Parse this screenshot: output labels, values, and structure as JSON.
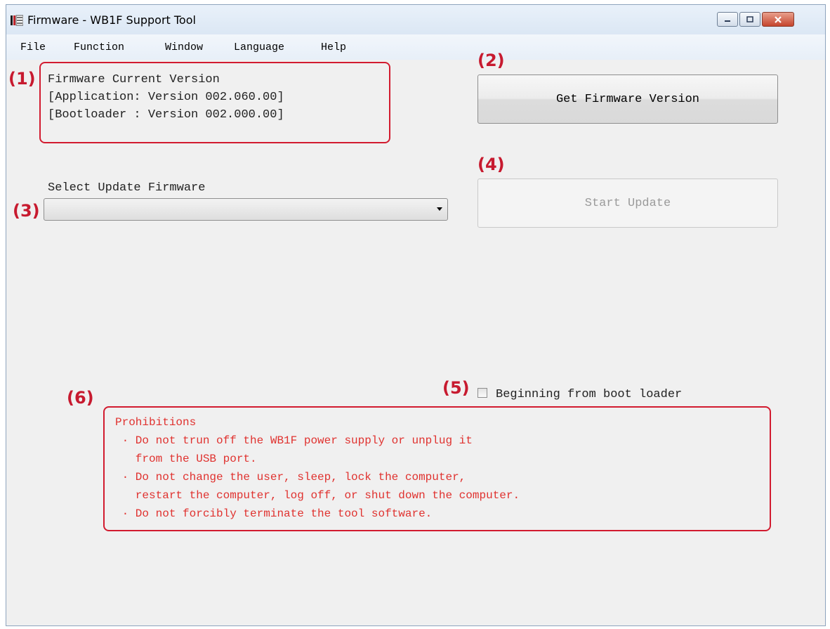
{
  "window": {
    "title": "Firmware - WB1F Support Tool"
  },
  "menu": [
    "File",
    "Function",
    "Window",
    "Language",
    "Help"
  ],
  "callouts": {
    "c1": "(1)",
    "c2": "(2)",
    "c3": "(3)",
    "c4": "(4)",
    "c5": "(5)",
    "c6": "(6)"
  },
  "version_panel": {
    "line1": "Firmware Current Version",
    "line2": "[Application: Version 002.060.00]",
    "line3": "[Bootloader : Version 002.000.00]"
  },
  "buttons": {
    "get_version": "Get Firmware Version",
    "start_update": "Start Update"
  },
  "select_update": {
    "label": "Select Update Firmware",
    "value": ""
  },
  "bootloader_checkbox": {
    "label": "Beginning from boot loader",
    "checked": false
  },
  "prohibitions": {
    "title": "Prohibitions",
    "lines": [
      " · Do not trun off the WB1F power supply or unplug it",
      "   from the USB port.",
      " · Do not change the user, sleep, lock the computer,",
      "   restart the computer, log off, or shut down the computer.",
      " · Do not forcibly terminate the tool software."
    ]
  },
  "colors": {
    "callout": "#c71a2f",
    "prohibition_text": "#e0322f",
    "window_chrome": "#e6f0f9"
  }
}
